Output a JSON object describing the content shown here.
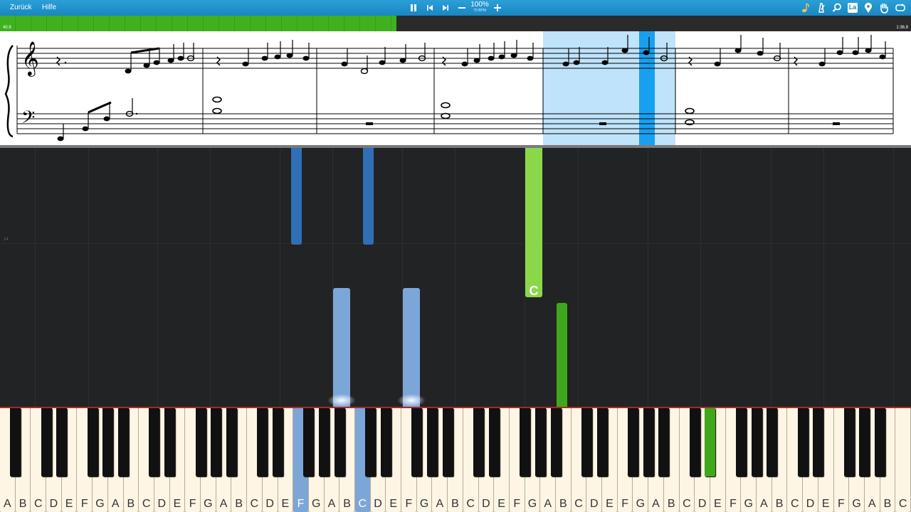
{
  "toolbar": {
    "back_label": "Zurück",
    "help_label": "Hilfe",
    "speed_percent": "100%",
    "speed_bpm": "70 BPM",
    "controls": [
      "pause-icon",
      "previous-icon",
      "next-icon",
      "minus-icon",
      "plus-icon"
    ],
    "right_icons": [
      "note-icon",
      "metronome-icon",
      "search-icon",
      "label-icon",
      "location-icon",
      "hand-icon",
      "loop-icon"
    ],
    "label_icon_text": "La"
  },
  "progress": {
    "elapsed": "40.9",
    "total": "1:36.8",
    "fraction": 0.435
  },
  "waterfall": {
    "measure_number": "14",
    "active_note_label": "C"
  },
  "keyboard": {
    "white_keys": [
      "A",
      "B",
      "C",
      "D",
      "E",
      "F",
      "G",
      "A",
      "B",
      "C",
      "D",
      "E",
      "F",
      "G",
      "A",
      "B",
      "C",
      "D",
      "E",
      "F",
      "G",
      "A",
      "B",
      "C",
      "D",
      "E",
      "F",
      "G",
      "A",
      "B",
      "C",
      "D",
      "E",
      "F",
      "G",
      "A",
      "B",
      "C",
      "D",
      "E",
      "F",
      "G",
      "A",
      "B",
      "C",
      "D",
      "E",
      "F",
      "G",
      "A",
      "B",
      "C",
      "D",
      "E",
      "F",
      "G",
      "A",
      "B",
      "C"
    ],
    "pressed_white": [
      19,
      23
    ],
    "pressed_black_green": 32
  },
  "colors": {
    "toolbar": "#1a86c2",
    "progress_fill": "#3fb11f",
    "right_hand_light": "#8bd74a",
    "right_hand_dark": "#3fa81a",
    "left_hand_dark": "#2f6fb8",
    "left_hand_light": "#7da6d8",
    "score_highlight": "#bfe3fb",
    "score_cursor": "#18a0f0"
  }
}
